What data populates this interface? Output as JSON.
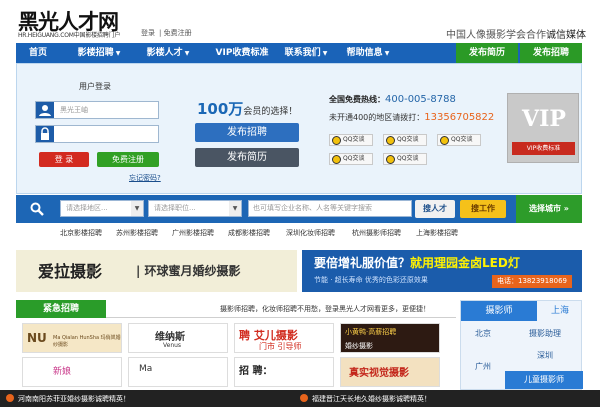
{
  "header": {
    "logo_text": "黑光人才网",
    "logo_sub": "HR.HEIGUANG.COM中国影楼招聘门户",
    "login_link": "登录",
    "register_link": "免费注册",
    "slogan_a": "中国人像摄影学会合作",
    "slogan_b": "诚信媒体"
  },
  "nav": {
    "items": [
      {
        "label": "首页"
      },
      {
        "label": "影楼招聘"
      },
      {
        "label": "影楼人才"
      },
      {
        "label": "VIP收费标准"
      },
      {
        "label": "联系我们"
      },
      {
        "label": "帮助信息"
      }
    ],
    "post_resume": "发布简历",
    "post_job": "发布招聘"
  },
  "login": {
    "title": "用户登录",
    "username_placeholder": "黑光王岫",
    "password_placeholder": "",
    "login_btn": "登 录",
    "register_btn": "免费注册",
    "forgot": "忘记密码?"
  },
  "members": {
    "count": "100万",
    "suffix": "会员的选择！",
    "post_job": "发布招聘",
    "post_resume": "发布简历"
  },
  "hotline": {
    "label": "全国免费热线：",
    "number": "400-005-8788",
    "alt_label": "未开通400的地区请拨打：",
    "alt_number": "13356705822",
    "qq": [
      "QQ交谈",
      "QQ交谈",
      "QQ交谈",
      "QQ交谈",
      "QQ交谈"
    ]
  },
  "vip": {
    "text": "VIP",
    "tag": "VIP收费标准"
  },
  "search": {
    "region_placeholder": "请选择地区...",
    "position_placeholder": "请选择职位...",
    "keyword_placeholder": "也可填写企业名称、人名等关键字搜索",
    "find_talent": "搜人才",
    "find_job": "搜工作",
    "city": "选择城市 »"
  },
  "city_links": [
    "北京影楼招聘",
    "苏州影楼招聘",
    "广州影楼招聘",
    "成都影楼招聘",
    "深圳化妆师招聘",
    "杭州摄影师招聘",
    "上海影楼招聘"
  ],
  "banner1": {
    "t1": "爱拉摄影",
    "t2": "| 环球蜜月婚纱摄影"
  },
  "banner2": {
    "t1a": "要倍增礼服价值？",
    "t1b": "就用理园金卤LED灯",
    "t2": "节能 · 超长寿命 优秀的色彩还原效果",
    "t3": "电话：13823918069"
  },
  "urgent": {
    "tab": "紧急招聘",
    "message": "摄影师招聘，化妆师招聘不用愁，登录黑光人才网看更多，更便捷！"
  },
  "tiles": [
    {
      "text": "NU",
      "sub": "Ma Qialan HunSha 玛俏岚婚纱摄影"
    },
    {
      "text": "维纳斯",
      "sub": "Venus"
    },
    {
      "text": "聘 艾儿摄影",
      "sub": "门市  引导师"
    },
    {
      "text": "小黄鸭·高薪招聘",
      "sub": "婚纱摄影"
    },
    {
      "text": "新娘",
      "sub": ""
    },
    {
      "text": "Ma",
      "sub": ""
    },
    {
      "text": "招 聘：",
      "sub": ""
    },
    {
      "text": "真实视觉摄影",
      "sub": ""
    }
  ],
  "side": {
    "tab_a": "摄影师",
    "tab_b": "上海",
    "beijing": "北京",
    "assist": "摄影助理",
    "guangzhou": "广州",
    "shenzhen": "深圳",
    "kids": "儿童摄影师"
  },
  "bottom": {
    "left": "河南南阳苏菲亚婚纱摄影诚聘精英！",
    "right": "福建晋江天长地久婚纱摄影诚聘精英！"
  },
  "colors": {
    "nav_blue": "#1a63b8",
    "green": "#2b9a26",
    "red": "#d32b20",
    "orange": "#e8641c"
  }
}
